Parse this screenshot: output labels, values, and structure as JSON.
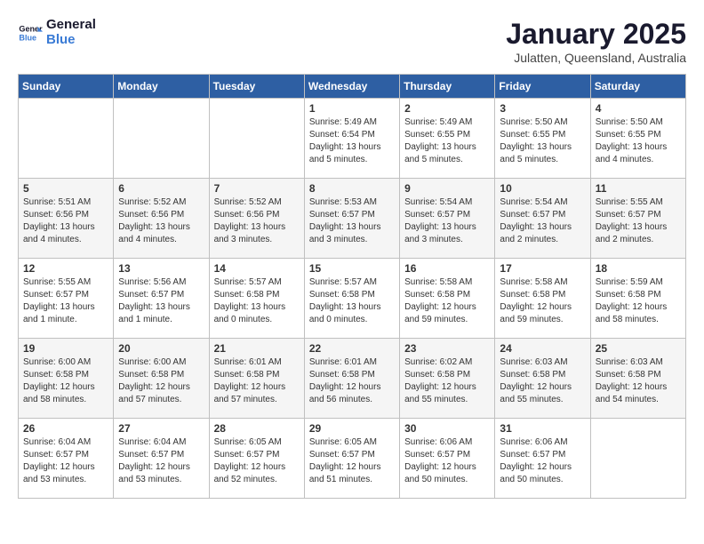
{
  "logo": {
    "line1": "General",
    "line2": "Blue"
  },
  "title": "January 2025",
  "subtitle": "Julatten, Queensland, Australia",
  "days_of_week": [
    "Sunday",
    "Monday",
    "Tuesday",
    "Wednesday",
    "Thursday",
    "Friday",
    "Saturday"
  ],
  "weeks": [
    [
      {
        "day": "",
        "info": ""
      },
      {
        "day": "",
        "info": ""
      },
      {
        "day": "",
        "info": ""
      },
      {
        "day": "1",
        "info": "Sunrise: 5:49 AM\nSunset: 6:54 PM\nDaylight: 13 hours and 5 minutes."
      },
      {
        "day": "2",
        "info": "Sunrise: 5:49 AM\nSunset: 6:55 PM\nDaylight: 13 hours and 5 minutes."
      },
      {
        "day": "3",
        "info": "Sunrise: 5:50 AM\nSunset: 6:55 PM\nDaylight: 13 hours and 5 minutes."
      },
      {
        "day": "4",
        "info": "Sunrise: 5:50 AM\nSunset: 6:55 PM\nDaylight: 13 hours and 4 minutes."
      }
    ],
    [
      {
        "day": "5",
        "info": "Sunrise: 5:51 AM\nSunset: 6:56 PM\nDaylight: 13 hours and 4 minutes."
      },
      {
        "day": "6",
        "info": "Sunrise: 5:52 AM\nSunset: 6:56 PM\nDaylight: 13 hours and 4 minutes."
      },
      {
        "day": "7",
        "info": "Sunrise: 5:52 AM\nSunset: 6:56 PM\nDaylight: 13 hours and 3 minutes."
      },
      {
        "day": "8",
        "info": "Sunrise: 5:53 AM\nSunset: 6:57 PM\nDaylight: 13 hours and 3 minutes."
      },
      {
        "day": "9",
        "info": "Sunrise: 5:54 AM\nSunset: 6:57 PM\nDaylight: 13 hours and 3 minutes."
      },
      {
        "day": "10",
        "info": "Sunrise: 5:54 AM\nSunset: 6:57 PM\nDaylight: 13 hours and 2 minutes."
      },
      {
        "day": "11",
        "info": "Sunrise: 5:55 AM\nSunset: 6:57 PM\nDaylight: 13 hours and 2 minutes."
      }
    ],
    [
      {
        "day": "12",
        "info": "Sunrise: 5:55 AM\nSunset: 6:57 PM\nDaylight: 13 hours and 1 minute."
      },
      {
        "day": "13",
        "info": "Sunrise: 5:56 AM\nSunset: 6:57 PM\nDaylight: 13 hours and 1 minute."
      },
      {
        "day": "14",
        "info": "Sunrise: 5:57 AM\nSunset: 6:58 PM\nDaylight: 13 hours and 0 minutes."
      },
      {
        "day": "15",
        "info": "Sunrise: 5:57 AM\nSunset: 6:58 PM\nDaylight: 13 hours and 0 minutes."
      },
      {
        "day": "16",
        "info": "Sunrise: 5:58 AM\nSunset: 6:58 PM\nDaylight: 12 hours and 59 minutes."
      },
      {
        "day": "17",
        "info": "Sunrise: 5:58 AM\nSunset: 6:58 PM\nDaylight: 12 hours and 59 minutes."
      },
      {
        "day": "18",
        "info": "Sunrise: 5:59 AM\nSunset: 6:58 PM\nDaylight: 12 hours and 58 minutes."
      }
    ],
    [
      {
        "day": "19",
        "info": "Sunrise: 6:00 AM\nSunset: 6:58 PM\nDaylight: 12 hours and 58 minutes."
      },
      {
        "day": "20",
        "info": "Sunrise: 6:00 AM\nSunset: 6:58 PM\nDaylight: 12 hours and 57 minutes."
      },
      {
        "day": "21",
        "info": "Sunrise: 6:01 AM\nSunset: 6:58 PM\nDaylight: 12 hours and 57 minutes."
      },
      {
        "day": "22",
        "info": "Sunrise: 6:01 AM\nSunset: 6:58 PM\nDaylight: 12 hours and 56 minutes."
      },
      {
        "day": "23",
        "info": "Sunrise: 6:02 AM\nSunset: 6:58 PM\nDaylight: 12 hours and 55 minutes."
      },
      {
        "day": "24",
        "info": "Sunrise: 6:03 AM\nSunset: 6:58 PM\nDaylight: 12 hours and 55 minutes."
      },
      {
        "day": "25",
        "info": "Sunrise: 6:03 AM\nSunset: 6:58 PM\nDaylight: 12 hours and 54 minutes."
      }
    ],
    [
      {
        "day": "26",
        "info": "Sunrise: 6:04 AM\nSunset: 6:57 PM\nDaylight: 12 hours and 53 minutes."
      },
      {
        "day": "27",
        "info": "Sunrise: 6:04 AM\nSunset: 6:57 PM\nDaylight: 12 hours and 53 minutes."
      },
      {
        "day": "28",
        "info": "Sunrise: 6:05 AM\nSunset: 6:57 PM\nDaylight: 12 hours and 52 minutes."
      },
      {
        "day": "29",
        "info": "Sunrise: 6:05 AM\nSunset: 6:57 PM\nDaylight: 12 hours and 51 minutes."
      },
      {
        "day": "30",
        "info": "Sunrise: 6:06 AM\nSunset: 6:57 PM\nDaylight: 12 hours and 50 minutes."
      },
      {
        "day": "31",
        "info": "Sunrise: 6:06 AM\nSunset: 6:57 PM\nDaylight: 12 hours and 50 minutes."
      },
      {
        "day": "",
        "info": ""
      }
    ]
  ]
}
